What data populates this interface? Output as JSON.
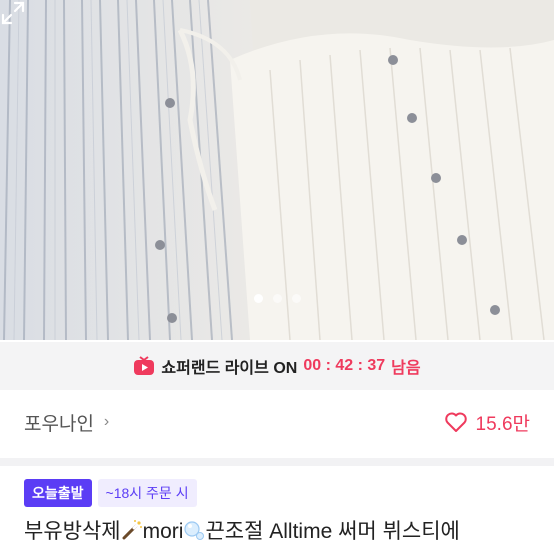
{
  "product_image": {
    "slide_count": 3,
    "active_slide": 1
  },
  "live_banner": {
    "label": "쇼퍼랜드 라이브 ON",
    "time": "00 : 42 : 37",
    "suffix": "남음",
    "accent_color": "#ef3a5d"
  },
  "store": {
    "name": "포우나인",
    "chevron": "›",
    "likes": "15.6만"
  },
  "badges": {
    "today": "오늘출발",
    "deadline": "~18시 주문 시"
  },
  "title": {
    "part1": "부유방삭제",
    "part2": "mori",
    "part3": "끈조절 Alltime 써머 뷔스티에"
  },
  "colors": {
    "brand": "#5b3df5",
    "like": "#ef3a5d"
  },
  "icons": [
    "live-tv-icon",
    "heart-icon",
    "expand-icon",
    "magic-wand-icon",
    "bubbles-icon"
  ]
}
